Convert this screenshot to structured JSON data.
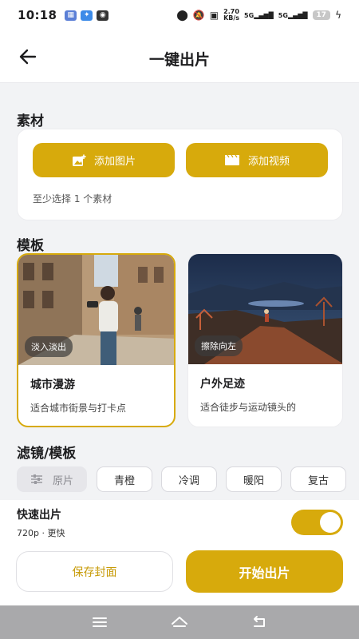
{
  "status_bar": {
    "time": "10:18",
    "net_speed_value": "2.70",
    "net_speed_unit": "KB/s",
    "signal_1": "5G",
    "signal_2": "5G",
    "battery": "17",
    "icons": [
      "app-icon",
      "app-icon",
      "app-icon",
      "location-icon",
      "mute-icon",
      "contact-icon",
      "charging-icon"
    ]
  },
  "header": {
    "title": "一键出片",
    "back_icon": "arrow-left-icon"
  },
  "material": {
    "section_title": "素材",
    "add_image_label": "添加图片",
    "add_video_label": "添加视频",
    "hint": "至少选择 1 个素材",
    "accent": "#d7aa0c"
  },
  "templates": {
    "section_title": "模板",
    "items": [
      {
        "name": "城市漫游",
        "tag": "淡入淡出",
        "desc": "适合城市街景与打卡点",
        "selected": true
      },
      {
        "name": "户外足迹",
        "tag": "擦除向左",
        "desc": "适合徒步与运动镜头的",
        "selected": false
      }
    ]
  },
  "filters": {
    "section_title": "滤镜/模板",
    "chips": [
      "原片",
      "青橙",
      "冷调",
      "暖阳",
      "复古"
    ],
    "selected": "原片"
  },
  "quick_export": {
    "title": "快速出片",
    "subtitle": "720p · 更快",
    "enabled": true
  },
  "actions": {
    "save_cover": "保存封面",
    "start": "开始出片"
  },
  "nav": {
    "icons": [
      "menu-icon",
      "home-icon",
      "back-icon"
    ]
  }
}
